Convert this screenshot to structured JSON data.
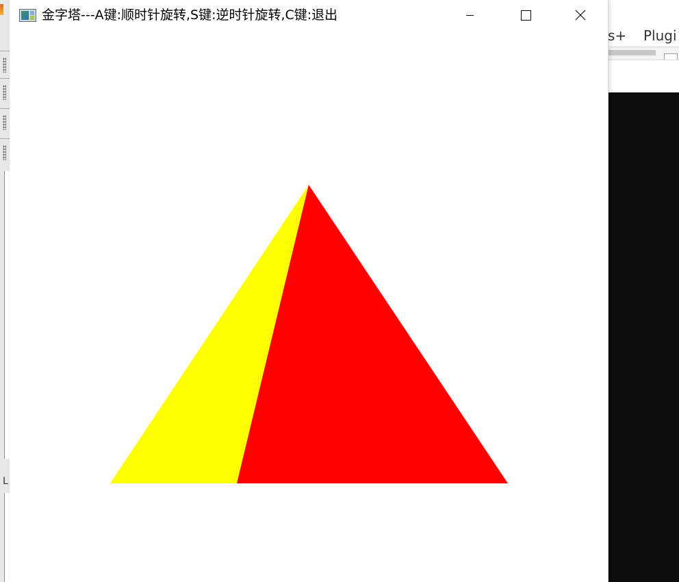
{
  "window": {
    "title": "金字塔---A键:顺时针旋转,S键:逆时针旋转,C键:退出",
    "icon": "app-window-icon",
    "controls": {
      "minimize": "minimize-icon",
      "maximize": "maximize-icon",
      "close": "close-icon"
    }
  },
  "scene": {
    "background": "#ffffff",
    "faces": [
      {
        "name": "left-face",
        "color": "#ffff00"
      },
      {
        "name": "right-face",
        "color": "#ff0000"
      }
    ]
  },
  "background_app": {
    "menu": {
      "tools_partial": "s+",
      "plugins_partial": "Plugi"
    },
    "left_panel_letter": "L",
    "terminal_color": "#0c0c0c"
  }
}
